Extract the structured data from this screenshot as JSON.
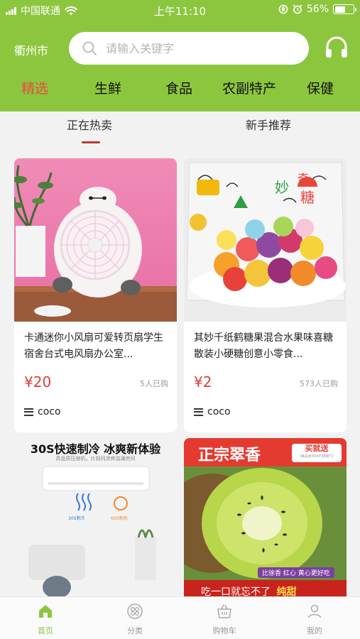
{
  "status_bar": {
    "carrier": "中国联通",
    "time": "上午11:10",
    "battery": "56%",
    "battery_level": 0.56
  },
  "header": {
    "city": "衢州市",
    "search_placeholder": "请输入关键字",
    "categories": [
      "精选",
      "生鲜",
      "食品",
      "农副特产",
      "保健"
    ],
    "active_category": 0
  },
  "subtabs": {
    "items": [
      "正在热卖",
      "新手推荐"
    ],
    "active": 0
  },
  "products": [
    {
      "title": "卡通迷你小风扇可爱转页扇学生宿舍台式电风扇办公室...",
      "price": "¥20",
      "sold": "5人已购",
      "shop": "coco"
    },
    {
      "title": "其妙千纸鹤糖果混合水果味喜糖散装小硬糖创意小零食...",
      "price": "¥2",
      "sold": "573人已购",
      "shop": "coco"
    },
    {
      "headline": "30S快速制冷 冰爽新体验",
      "subline": "高品质压缩机，片刻间凉爽溢满房间",
      "badge_left": "30S制冷",
      "badge_right": "60S制热"
    },
    {
      "headline": "正宗翠香",
      "badge": "买就送",
      "badge_small": "（美品级304不锈钢勺）",
      "tagline": "比徐香 红心 黄心更好吃",
      "slogan": "吃一口就忘不了",
      "slogan_strong": "纯甜"
    }
  ],
  "bottom_nav": {
    "items": [
      "首页",
      "分类",
      "购物车",
      "我的"
    ],
    "active": 0
  },
  "colors": {
    "brand_green": "#8cc63f",
    "active_red": "#e84c3d",
    "price_red": "#d6403a"
  }
}
